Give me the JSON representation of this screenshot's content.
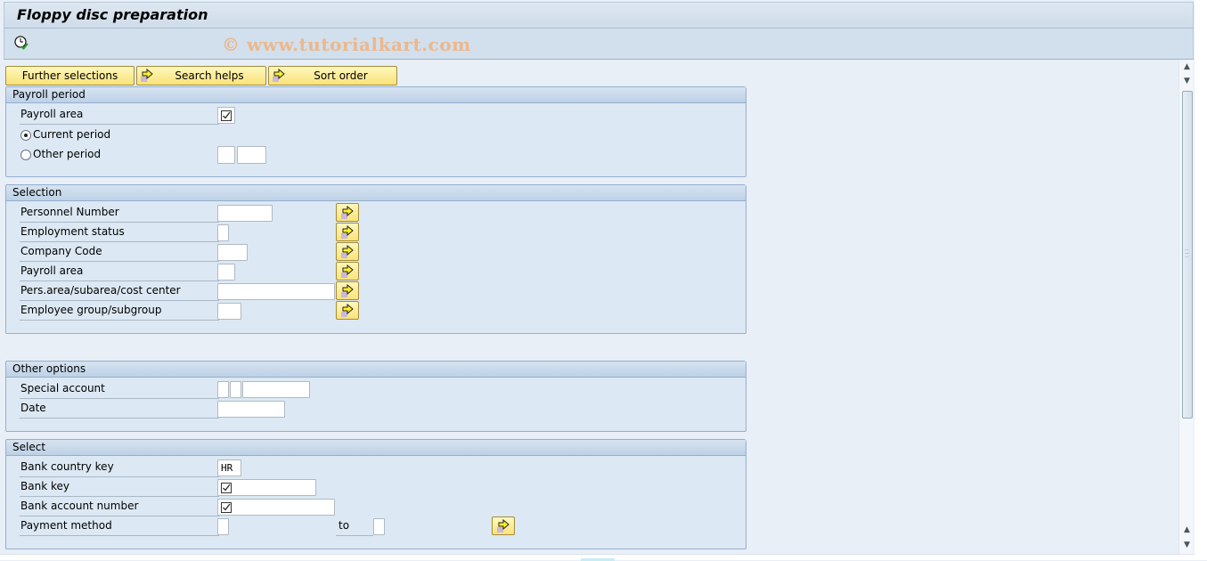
{
  "window": {
    "title": "Floppy disc preparation",
    "watermark": "© www.tutorialkart.com"
  },
  "toolbar": {
    "execute_icon": "execute-clock-icon"
  },
  "buttons": {
    "further_selections": "Further selections",
    "search_helps": "Search helps",
    "sort_order": "Sort order"
  },
  "payroll_period": {
    "title": "Payroll period",
    "payroll_area_label": "Payroll area",
    "payroll_area_checked": true,
    "current_period_label": "Current period",
    "other_period_label": "Other period",
    "selected_option": "Current period",
    "other_period_value1": "",
    "other_period_value2": ""
  },
  "selection": {
    "title": "Selection",
    "rows": [
      {
        "label": "Personnel Number",
        "value": ""
      },
      {
        "label": "Employment status",
        "value": ""
      },
      {
        "label": "Company Code",
        "value": ""
      },
      {
        "label": "Payroll area",
        "value": ""
      },
      {
        "label": "Pers.area/subarea/cost center",
        "value": ""
      },
      {
        "label": "Employee group/subgroup",
        "value": ""
      }
    ]
  },
  "other_options": {
    "title": "Other options",
    "special_account_label": "Special account",
    "special_account_values": [
      "",
      "",
      ""
    ],
    "date_label": "Date",
    "date_value": ""
  },
  "select": {
    "title": "Select",
    "bank_country_key_label": "Bank country key",
    "bank_country_key_value": "HR",
    "bank_key_label": "Bank key",
    "bank_key_required": true,
    "bank_account_number_label": "Bank account number",
    "bank_account_number_required": true,
    "payment_method_label": "Payment method",
    "payment_method_from": "",
    "to_label": "to",
    "payment_method_to": ""
  },
  "scrollbar": {
    "up_arrow": "▲",
    "down_arrow": "▼"
  },
  "colors": {
    "button_yellow": "#f9e379",
    "group_background": "#dce8f3",
    "group_border": "#93afd0",
    "watermark": "#ebb88d"
  }
}
